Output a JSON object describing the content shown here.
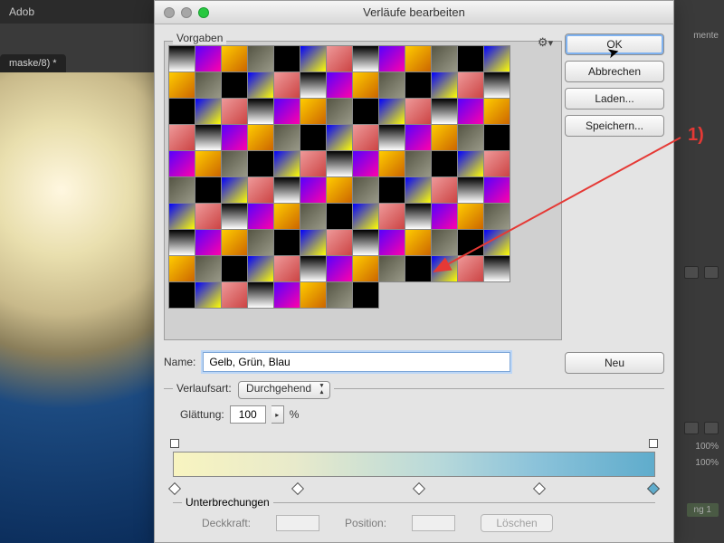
{
  "app_visible_name": "Adob",
  "tab": "maske/8) *",
  "right_panel": {
    "menu": "mente",
    "percents": [
      "100%",
      "100%"
    ],
    "tag": "ng 1"
  },
  "dialog": {
    "title": "Verläufe bearbeiten",
    "presets_label": "Vorgaben",
    "gear_label": "Vorgaben-Menü",
    "buttons": {
      "ok": "OK",
      "cancel": "Abbrechen",
      "load": "Laden...",
      "save": "Speichern...",
      "new": "Neu"
    },
    "name_label": "Name:",
    "name_value": "Gelb, Grün, Blau",
    "type_label": "Verlaufsart:",
    "type_value": "Durchgehend",
    "smooth_label": "Glättung:",
    "smooth_value": "100",
    "smooth_unit": "%",
    "interrupts_label": "Unterbrechungen",
    "opacity_label": "Deckkraft:",
    "position_label": "Position:",
    "delete_label": "Löschen",
    "gradient_stops": {
      "opacity": [
        0,
        100
      ],
      "color": [
        0,
        25,
        50,
        75,
        100
      ]
    }
  },
  "annotation": "1)",
  "chart_data": {
    "type": "table",
    "note": "gradient preset swatch grid",
    "columns": 13,
    "rows": 10,
    "last_row_count": 8,
    "colors": {
      "accent": "#7ea7d8",
      "anno": "#e53935"
    }
  }
}
